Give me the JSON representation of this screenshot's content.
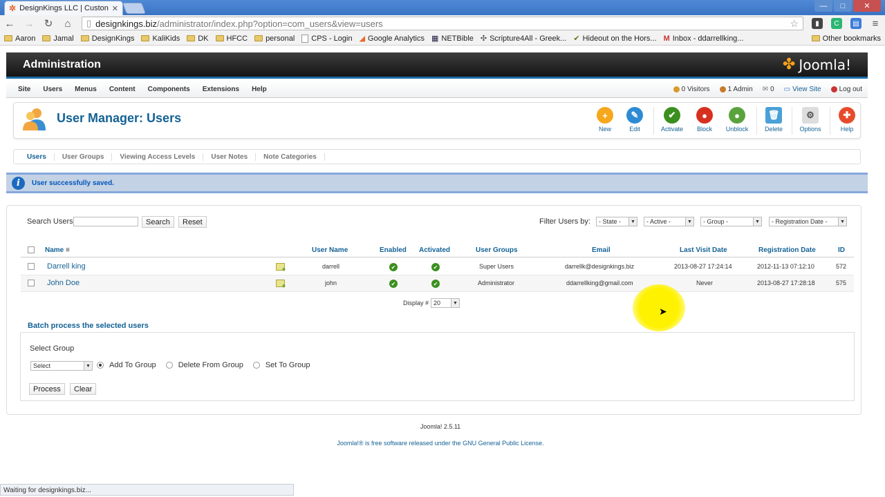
{
  "browser": {
    "tab_title": "DesignKings LLC | Custon",
    "url_domain": "designkings.biz",
    "url_path": "/administrator/index.php?option=com_users&view=users",
    "window_buttons": [
      "—",
      "□",
      "✕"
    ],
    "bookmarks": [
      "Aaron",
      "Jamal",
      "DesignKings",
      "KaliKids",
      "DK",
      "HFCC",
      "personal",
      "CPS - Login",
      "Google Analytics",
      "NETBible",
      "Scripture4All - Greek...",
      "Hideout on the Hors...",
      "Inbox - ddarrellking..."
    ],
    "other_bookmarks": "Other bookmarks",
    "status_text": "Waiting for designkings.biz..."
  },
  "header": {
    "title": "Administration",
    "logo": "Joomla!"
  },
  "menu": {
    "items": [
      "Site",
      "Users",
      "Menus",
      "Content",
      "Components",
      "Extensions",
      "Help"
    ],
    "visitors": "0 Visitors",
    "admins": "1 Admin",
    "messages": "0",
    "view_site": "View Site",
    "logout": "Log out"
  },
  "toolbar": {
    "page_title": "User Manager: Users",
    "new": "New",
    "edit": "Edit",
    "activate": "Activate",
    "block": "Block",
    "unblock": "Unblock",
    "delete": "Delete",
    "options": "Options",
    "help": "Help"
  },
  "subnav": [
    "Users",
    "User Groups",
    "Viewing Access Levels",
    "User Notes",
    "Note Categories"
  ],
  "message": "User successfully saved.",
  "search": {
    "label": "Search Users",
    "value": "",
    "search_button": "Search",
    "reset_button": "Reset"
  },
  "filters": {
    "label": "Filter Users by:",
    "state": "- State -",
    "active": "- Active -",
    "group": "- Group -",
    "registration": "- Registration Date -"
  },
  "table": {
    "headers": {
      "name": "Name",
      "username": "User Name",
      "enabled": "Enabled",
      "activated": "Activated",
      "groups": "User Groups",
      "email": "Email",
      "last_visit": "Last Visit Date",
      "registration": "Registration Date",
      "id": "ID"
    },
    "rows": [
      {
        "name": "Darrell king",
        "username": "darrell",
        "groups": "Super Users",
        "email": "darrellk@designkings.biz",
        "last_visit": "2013-08-27 17:24:14",
        "registration": "2012-11-13 07:12:10",
        "id": "572"
      },
      {
        "name": "John Doe",
        "username": "john",
        "groups": "Administrator",
        "email": "ddarrellking@gmail.com",
        "last_visit": "Never",
        "registration": "2013-08-27 17:28:18",
        "id": "575"
      }
    ]
  },
  "display": {
    "label": "Display #",
    "value": "20"
  },
  "batch": {
    "legend": "Batch process the selected users",
    "select_group_label": "Select Group",
    "select_value": "Select",
    "add": "Add To Group",
    "delete": "Delete From Group",
    "set": "Set To Group",
    "process": "Process",
    "clear": "Clear"
  },
  "footer": {
    "version": "Joomla! 2.5.11",
    "license_prefix": "Joomla!® is free software released under the",
    "license_link": "GNU General Public License",
    "license_suffix": "."
  }
}
